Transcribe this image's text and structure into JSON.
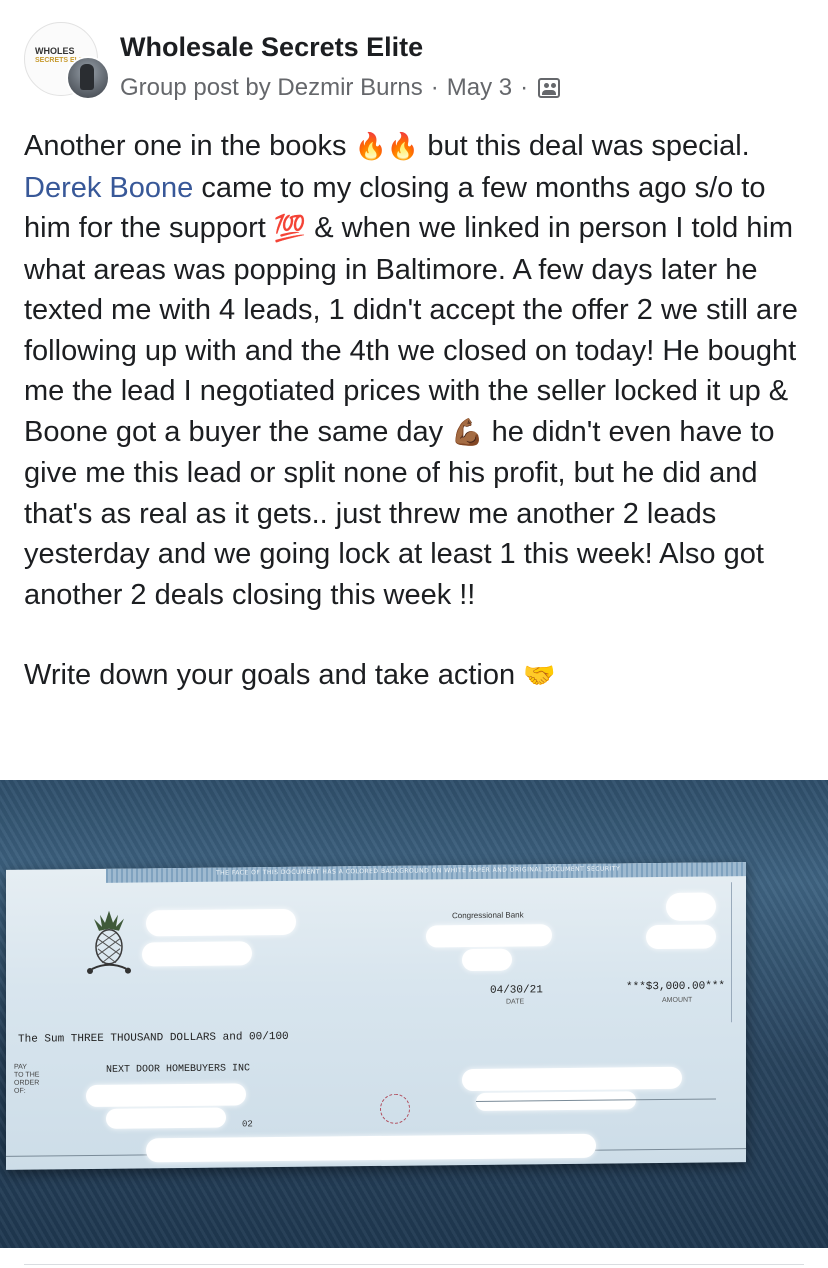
{
  "header": {
    "group_name": "Wholesale Secrets Elite",
    "group_logo_text": "WHOLES",
    "group_logo_sub": "SECRETS ELITE",
    "post_meta_prefix": "Group post by",
    "author": "Dezmir Burns",
    "separator": "·",
    "date": "May 3",
    "privacy_icon": "members-icon"
  },
  "post": {
    "p1": {
      "a": "Another one in the books ",
      "emoji1": "🔥🔥",
      "b": " but this deal was special. ",
      "mention": "Derek Boone",
      "c": " came to my closing a few months ago s/o to him for the support ",
      "emoji2": "💯",
      "d": " & when we linked in person I told him what areas was popping in Baltimore. A few days later he texted me with 4 leads, 1 didn't accept the offer 2 we still are following up with and the 4th we closed on today! He bought me the lead I negotiated prices with the seller locked it up & Boone got a buyer the same day ",
      "emoji3": "💪🏾",
      "e": " he didn't even have to give me this lead or split none of his profit, but he did and that's as real as it gets.. just threw me another 2 leads yesterday and we going lock at least 1 this week! Also got another 2 deals closing this week !!"
    },
    "p2": {
      "text": "Write down your goals and take action ",
      "emoji": "🤝"
    }
  },
  "check": {
    "band_text": "THE FACE OF THIS DOCUMENT HAS A COLORED BACKGROUND ON WHITE PAPER AND ORIGINAL DOCUMENT SECURITY",
    "bank_name": "Congressional Bank",
    "date": "04/30/21",
    "date_label": "DATE",
    "amount": "***$3,000.00***",
    "amount_label": "AMOUNT",
    "written_amount": "The Sum THREE THOUSAND DOLLARS and 00/100",
    "pay_label": "PAY\nTO THE\nORDER\nOF:",
    "payee": "NEXT DOOR HOMEBUYERS INC",
    "number_fragment": "02"
  },
  "colors": {
    "mention": "#385898",
    "meta": "#65676b",
    "text": "#1c1e21"
  }
}
